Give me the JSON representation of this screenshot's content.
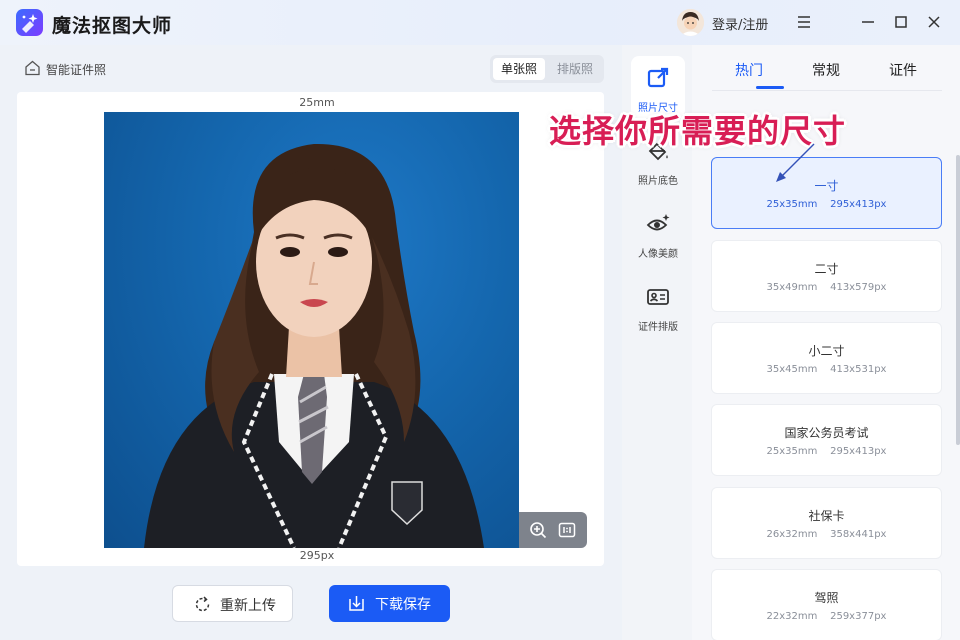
{
  "app": {
    "title": "魔法抠图大师",
    "login_label": "登录/注册"
  },
  "breadcrumb": {
    "label": "智能证件照"
  },
  "view_mode": {
    "options": [
      "单张照",
      "排版照"
    ],
    "selected": "单张照"
  },
  "canvas": {
    "width_label": "25mm",
    "pixel_label": "295px",
    "background_color": "#1466ad"
  },
  "actions": {
    "reupload_label": "重新上传",
    "download_label": "下载保存"
  },
  "tools": [
    {
      "label": "照片尺寸",
      "icon": "crop-icon",
      "active": true
    },
    {
      "label": "照片底色",
      "icon": "paint-bucket-icon",
      "active": false
    },
    {
      "label": "人像美颜",
      "icon": "eye-sparkle-icon",
      "active": false
    },
    {
      "label": "证件排版",
      "icon": "id-card-icon",
      "active": false
    }
  ],
  "tabs": [
    {
      "label": "热门",
      "active": true
    },
    {
      "label": "常规",
      "active": false
    },
    {
      "label": "证件",
      "active": false
    }
  ],
  "sizes": [
    {
      "name": "一寸",
      "spec": "25x35mm    295x413px",
      "selected": true
    },
    {
      "name": "二寸",
      "spec": "35x49mm    413x579px",
      "selected": false
    },
    {
      "name": "小二寸",
      "spec": "35x45mm    413x531px",
      "selected": false
    },
    {
      "name": "国家公务员考试",
      "spec": "25x35mm    295x413px",
      "selected": false
    },
    {
      "name": "社保卡",
      "spec": "26x32mm    358x441px",
      "selected": false
    },
    {
      "name": "驾照",
      "spec": "22x32mm    259x377px",
      "selected": false
    }
  ],
  "overlay": {
    "caption": "选择你所需要的尺寸"
  },
  "colors": {
    "accent": "#1b5bf5",
    "caption": "#d81e55",
    "selected_card_bg": "#eaf1ff"
  }
}
